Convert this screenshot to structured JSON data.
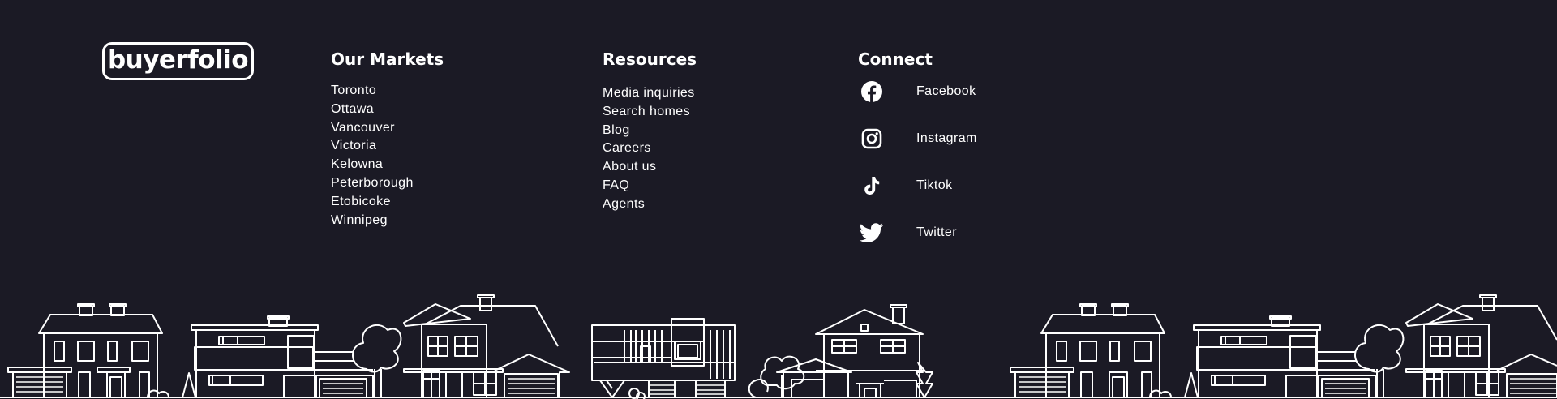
{
  "brand": {
    "logo_text": "buyerfolio"
  },
  "markets": {
    "heading": "Our Markets",
    "items": [
      "Toronto",
      "Ottawa",
      "Vancouver",
      "Victoria",
      "Kelowna",
      "Peterborough",
      "Etobicoke",
      "Winnipeg"
    ]
  },
  "resources": {
    "heading": "Resources",
    "items": [
      "Media inquiries",
      "Search homes",
      "Blog",
      "Careers",
      "About us",
      "FAQ",
      "Agents"
    ]
  },
  "connect": {
    "heading": "Connect",
    "items": [
      {
        "label": "Facebook",
        "icon": "facebook-icon"
      },
      {
        "label": "Instagram",
        "icon": "instagram-icon"
      },
      {
        "label": "Tiktok",
        "icon": "tiktok-icon"
      },
      {
        "label": "Twitter",
        "icon": "twitter-icon"
      }
    ]
  },
  "colors": {
    "background": "#1b1a25",
    "text": "#ffffff"
  }
}
